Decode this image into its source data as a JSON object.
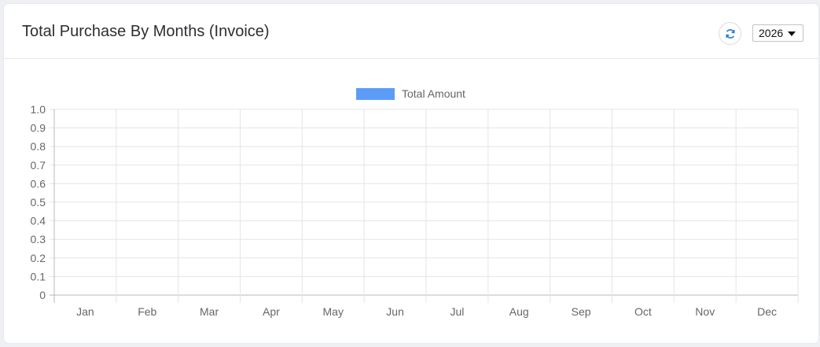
{
  "card": {
    "title": "Total Purchase By Months (Invoice)"
  },
  "controls": {
    "refresh_icon": "refresh-icon",
    "year_selected": "2026",
    "dropdown_icon": "caret-down-icon"
  },
  "colors": {
    "series": "#5b9cf7",
    "refresh_icon": "#2a7fc9"
  },
  "chart_data": {
    "type": "bar",
    "title": "",
    "xlabel": "",
    "ylabel": "",
    "categories": [
      "Jan",
      "Feb",
      "Mar",
      "Apr",
      "May",
      "Jun",
      "Jul",
      "Aug",
      "Sep",
      "Oct",
      "Nov",
      "Dec"
    ],
    "series": [
      {
        "name": "Total Amount",
        "values": [
          0,
          0,
          0,
          0,
          0,
          0,
          0,
          0,
          0,
          0,
          0,
          0
        ]
      }
    ],
    "ylim": [
      0,
      1.0
    ],
    "yticks": [
      "1.0",
      "0.9",
      "0.8",
      "0.7",
      "0.6",
      "0.5",
      "0.4",
      "0.3",
      "0.2",
      "0.1",
      "0"
    ],
    "grid": true,
    "legend_position": "top-center"
  }
}
